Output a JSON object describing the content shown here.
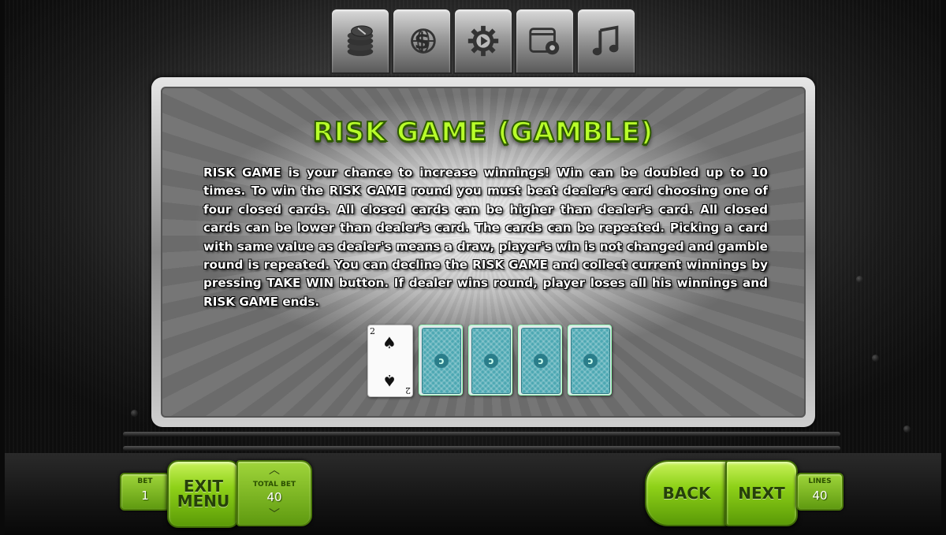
{
  "tabs": [
    {
      "name": "coins-stack-icon"
    },
    {
      "name": "globe-dollar-icon"
    },
    {
      "name": "gear-icon"
    },
    {
      "name": "window-settings-icon"
    },
    {
      "name": "music-note-icon"
    }
  ],
  "rules": {
    "title": "RISK GAME (GAMBLE)",
    "body": "RISK GAME is your chance to increase winnings! Win can be doubled up to 10 times. To win the RISK GAME round you must beat dealer's card choosing one of four closed cards. All closed cards can be higher than dealer's card. All closed cards can be lower than dealer's card. The cards can be repeated. Picking a card with same value as dealer's means a draw, player's win is not changed and gamble round is repeated. You can decline the RISK GAME and collect current winnings by pressing TAKE WIN button. If dealer wins round, player loses all his winnings and RISK GAME ends."
  },
  "cards": {
    "dealer": {
      "rank": "2",
      "suit": "♠"
    },
    "closed_count": 4
  },
  "controls": {
    "bet": {
      "label": "BET",
      "value": "1"
    },
    "exit_menu": {
      "line1": "EXIT",
      "line2": "MENU"
    },
    "total_bet": {
      "label": "TOTAL BET",
      "value": "40"
    },
    "back": "BACK",
    "next": "NEXT",
    "lines": {
      "label": "LINES",
      "value": "40"
    }
  },
  "colors": {
    "accent": "#8ed118",
    "title": "#b8ff2a"
  }
}
